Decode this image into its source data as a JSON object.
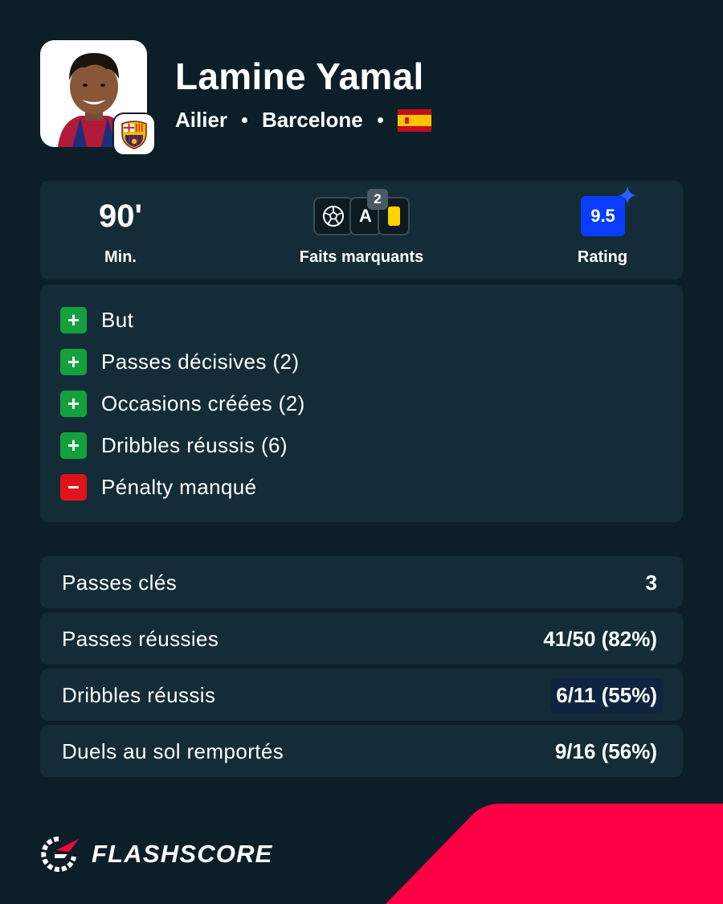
{
  "player": {
    "name": "Lamine Yamal",
    "position": "Ailier",
    "club": "Barcelone",
    "nationality_flag_icon": "spain-flag-icon",
    "club_badge_icon": "fc-barcelona-crest-icon"
  },
  "summary": {
    "minutes_value": "90'",
    "minutes_label": "Min.",
    "highlights_label": "Faits marquants",
    "highlights": {
      "icons": [
        "football-icon",
        "assist-icon",
        "yellow-card-icon"
      ],
      "assist_letter": "A",
      "assist_count": "2"
    },
    "rating_value": "9.5",
    "rating_label": "Rating"
  },
  "events": [
    {
      "type": "positive",
      "symbol": "+",
      "label": "But"
    },
    {
      "type": "positive",
      "symbol": "+",
      "label": "Passes décisives (2)"
    },
    {
      "type": "positive",
      "symbol": "+",
      "label": "Occasions créées (2)"
    },
    {
      "type": "positive",
      "symbol": "+",
      "label": "Dribbles réussis (6)"
    },
    {
      "type": "negative",
      "symbol": "−",
      "label": "Pénalty manqué"
    }
  ],
  "stats": [
    {
      "label": "Passes clés",
      "value": "3",
      "highlighted": false
    },
    {
      "label": "Passes réussies",
      "value": "41/50 (82%)",
      "highlighted": false
    },
    {
      "label": "Dribbles réussis",
      "value": "6/11 (55%)",
      "highlighted": true
    },
    {
      "label": "Duels au sol remportés",
      "value": "9/16 (56%)",
      "highlighted": false
    }
  ],
  "brand": {
    "name": "FLASHSCORE",
    "logo_icon": "flashscore-logo-icon",
    "accent_color": "#ff0046",
    "background_color": "#0c1f28",
    "card_color": "#142c37",
    "positive_color": "#14a03c",
    "negative_color": "#e0131a",
    "rating_color": "#0a3cff"
  }
}
